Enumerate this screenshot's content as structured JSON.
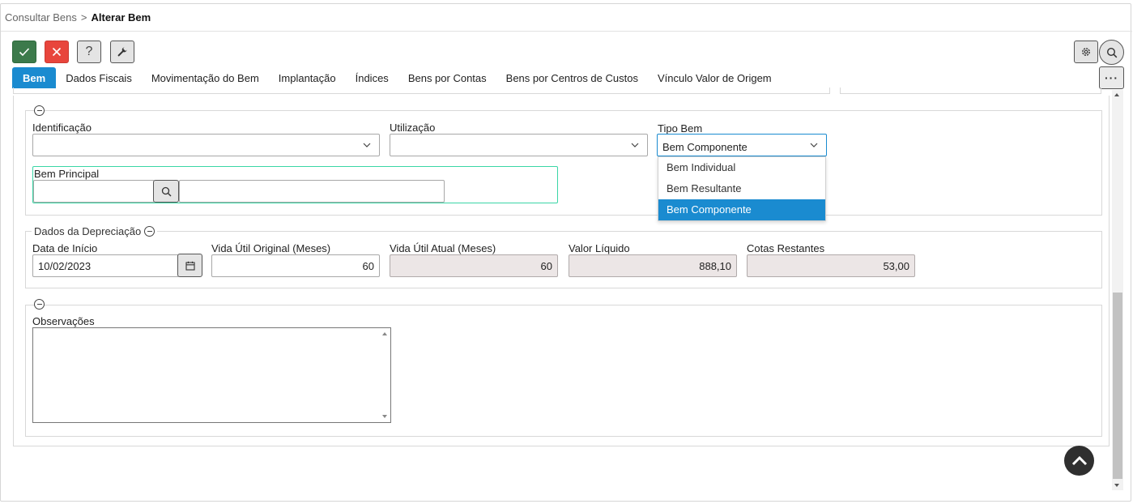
{
  "breadcrumb": {
    "parent": "Consultar Bens",
    "separator": ">",
    "current": "Alterar Bem"
  },
  "toolbar": {
    "confirm_icon": "check-icon",
    "cancel_icon": "close-icon",
    "help_label": "?",
    "tools_icon": "wrench-icon",
    "settings_icon": "gear-icon",
    "search_icon": "search-icon",
    "more_label": "···"
  },
  "tabs": [
    {
      "label": "Bem",
      "active": true
    },
    {
      "label": "Dados Fiscais"
    },
    {
      "label": "Movimentação do Bem"
    },
    {
      "label": "Implantação"
    },
    {
      "label": "Índices"
    },
    {
      "label": "Bens por Contas"
    },
    {
      "label": "Bens por Centros de Custos"
    },
    {
      "label": "Vínculo Valor de Origem"
    }
  ],
  "identificacao": {
    "label": "Identificação",
    "value": ""
  },
  "utilizacao": {
    "label": "Utilização",
    "value": ""
  },
  "tipo_bem": {
    "label": "Tipo Bem",
    "value": "Bem Componente",
    "options": [
      "Bem Individual",
      "Bem Resultante",
      "Bem Componente"
    ],
    "selected_index": 2
  },
  "bem_principal": {
    "label": "Bem Principal",
    "code": "",
    "description": ""
  },
  "depreciacao": {
    "legend": "Dados da Depreciação",
    "data_inicio": {
      "label": "Data de Início",
      "value": "10/02/2023"
    },
    "vida_util_original": {
      "label": "Vida Útil Original (Meses)",
      "value": "60"
    },
    "vida_util_atual": {
      "label": "Vida Útil Atual (Meses)",
      "value": "60"
    },
    "valor_liquido": {
      "label": "Valor Líquido",
      "value": "888,10"
    },
    "cotas_restantes": {
      "label": "Cotas Restantes",
      "value": "53,00"
    }
  },
  "observacoes": {
    "label": "Observações",
    "value": ""
  },
  "colors": {
    "accent": "#1a8bd0",
    "confirm": "#3c7a4b",
    "cancel": "#e8453c",
    "focus": "#3ad6a6"
  }
}
